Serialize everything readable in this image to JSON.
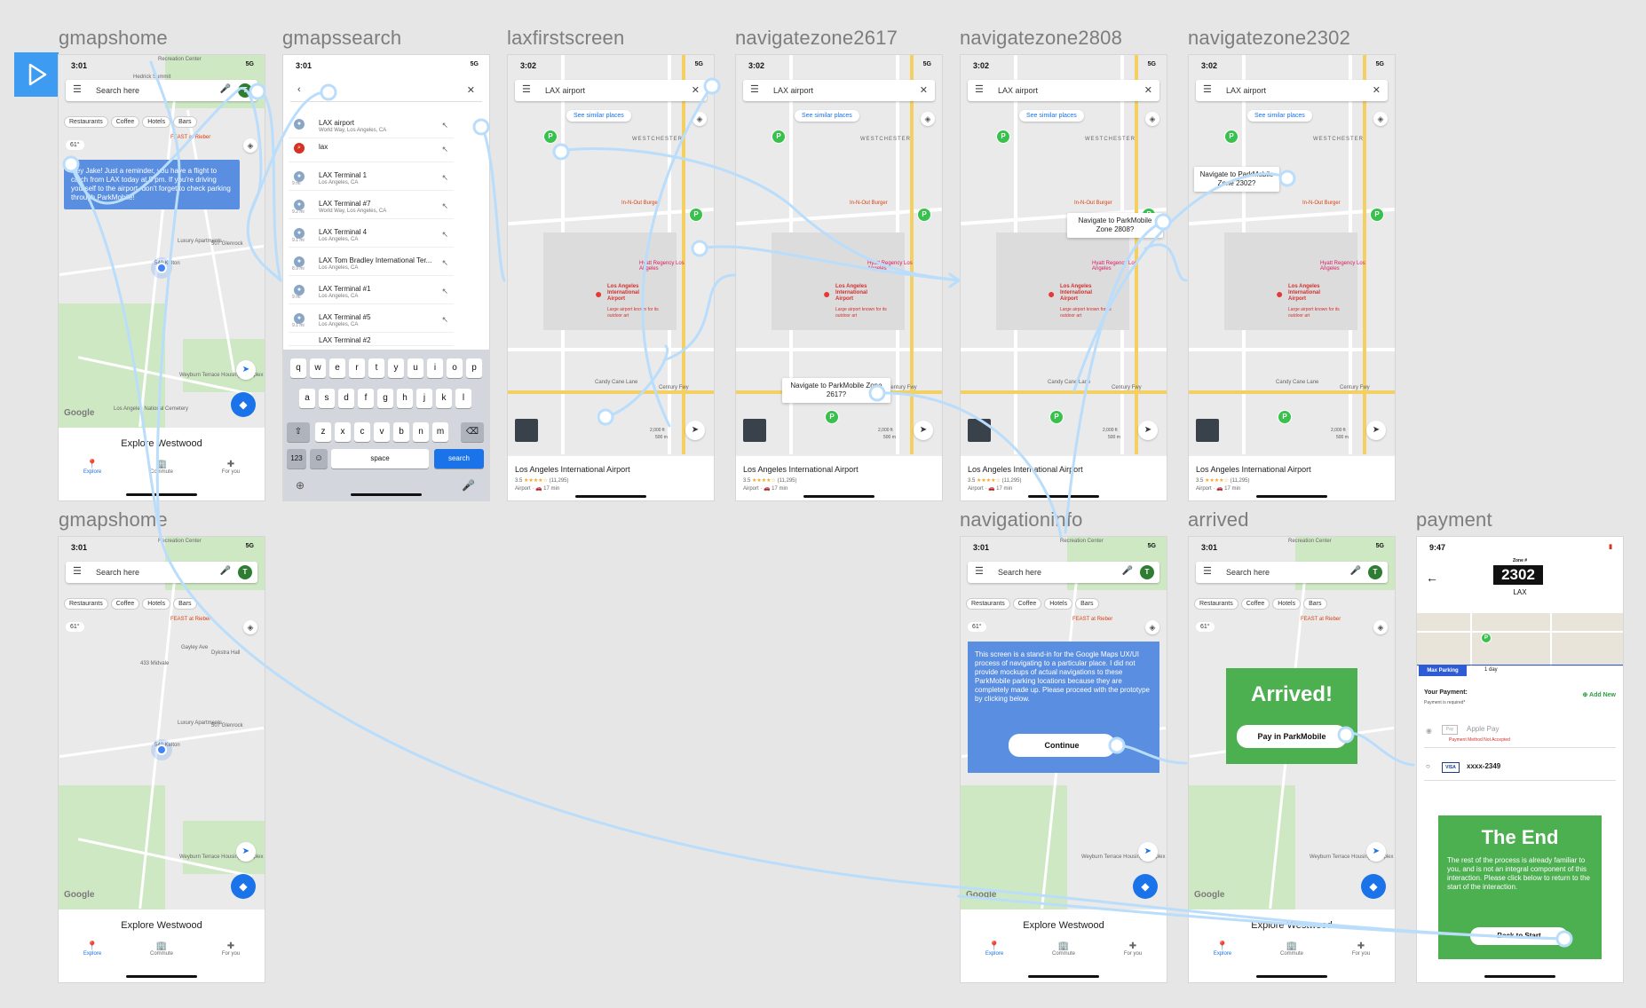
{
  "frame_titles": {
    "gmapshome": "gmapshome",
    "gmapssearch": "gmapssearch",
    "laxfirstscreen": "laxfirstscreen",
    "nav2617": "navigatezone2617",
    "nav2808": "navigatezone2808",
    "nav2302": "navigatezone2302",
    "gmapshome2": "gmapshome",
    "navigationinfo": "navigationinfo",
    "arrived": "arrived",
    "payment": "payment"
  },
  "status": {
    "time_a": "3:01",
    "time_b": "3:02",
    "time_pay": "9:47",
    "signal": "5G"
  },
  "home": {
    "search_placeholder": "Search here",
    "avatar": "T",
    "chips": [
      "Restaurants",
      "Coffee",
      "Hotels",
      "Bars"
    ],
    "temp": "61°",
    "explore": "Explore Westwood",
    "tabs": [
      "Explore",
      "Commute",
      "For you"
    ],
    "reminder": "Hey Jake! Just a reminder, you have a flight to catch from LAX today at 5 pm. If you're driving yourself to the airport, don't forget to check parking through ParkMobile!",
    "places": [
      "Recreation Center",
      "Hedrick Summit",
      "FEAST at Rieber",
      "Luxury Apartments",
      "507 Glenrock",
      "540 Kelton",
      "Weyburn Terrace Housing Complex",
      "Los Angeles National Cemetery",
      "433 Midvale",
      "Gayley Ave",
      "Dykstra Hall"
    ],
    "google": "Google"
  },
  "search": {
    "results": [
      {
        "title": "LAX airport",
        "sub": "World Way, Los Angeles, CA",
        "dist": ""
      },
      {
        "title": "lax",
        "sub": "",
        "dist": ""
      },
      {
        "title": "LAX Terminal 1",
        "sub": "Los Angeles, CA",
        "dist": "9 mi"
      },
      {
        "title": "LAX Terminal #7",
        "sub": "World Way, Los Angeles, CA",
        "dist": "9.2 mi"
      },
      {
        "title": "LAX Terminal 4",
        "sub": "Los Angeles, CA",
        "dist": "9.1 mi"
      },
      {
        "title": "LAX Tom Bradley International Ter...",
        "sub": "Los Angeles, CA",
        "dist": "8.9 mi"
      },
      {
        "title": "LAX Terminal #1",
        "sub": "Los Angeles, CA",
        "dist": "9 mi"
      },
      {
        "title": "LAX Terminal #5",
        "sub": "Los Angeles, CA",
        "dist": "9.1 mi"
      },
      {
        "title": "LAX Terminal #2",
        "sub": "",
        "dist": ""
      }
    ],
    "keys_row1": [
      "q",
      "w",
      "e",
      "r",
      "t",
      "y",
      "u",
      "i",
      "o",
      "p"
    ],
    "keys_row2": [
      "a",
      "s",
      "d",
      "f",
      "g",
      "h",
      "j",
      "k",
      "l"
    ],
    "keys_row3": [
      "z",
      "x",
      "c",
      "v",
      "b",
      "n",
      "m"
    ],
    "key_123": "123",
    "key_space": "space",
    "key_search": "search"
  },
  "lax": {
    "search_text": "LAX airport",
    "similar": "See similar places",
    "westchester": "WESTCHESTER",
    "pin_label": "Los Angeles International Airport",
    "pin_sub": "Large airport known for its outdoor art",
    "card_title": "Los Angeles International Airport",
    "rating": "3.5",
    "stars": "★★★★☆",
    "reviews": "(11,295)",
    "detail": "Airport · 🚗 17 min",
    "in_n_out": "In-N-Out Burger",
    "hyatt": "Hyatt Regency Los Angeles",
    "candy": "Candy Cane Lane",
    "century": "Century Fwy",
    "scale_ft": "2,000 ft",
    "scale_m": "500 m",
    "p_symbol": "P"
  },
  "tooltips": {
    "z2617": "Navigate to ParkMobile Zone 2617?",
    "z2808": "Navigate to ParkMobile Zone 2808?",
    "z2302": "Navigate to ParkMobile Zone 2302?"
  },
  "navinfo": {
    "text": "This screen is a stand-in for the Google Maps UX/UI process of navigating to a particular place. I did not provide mockups of actual navigations to these ParkMobile parking locations because they are completely made up. Please proceed with the prototype by clicking below.",
    "button": "Continue"
  },
  "arrived": {
    "title": "Arrived!",
    "button": "Pay in ParkMobile"
  },
  "payment": {
    "zone_label": "Zone #",
    "zone": "2302",
    "city": "LAX",
    "max_parking": "Max Parking",
    "duration": "1 day",
    "your_payment": "Your Payment:",
    "required": "Payment is required*",
    "add_new": "Add New",
    "apple_pay": "Apple Pay",
    "not_accepted": "Payment Method Not Accepted",
    "visa_label": "VISA",
    "card": "xxxx-2349",
    "end_title": "The End",
    "end_text": "The rest of the process is already familiar to you, and is not an integral component of this interaction. Please click below to return to the start of the interaction.",
    "back": "Back to Start"
  },
  "colors": {
    "accent": "#1a73e8",
    "park_green": "#38c24d",
    "wire": "#b9ddfb",
    "overlay_blue": "#5a8ee0",
    "arrived_green": "#4caf50"
  }
}
